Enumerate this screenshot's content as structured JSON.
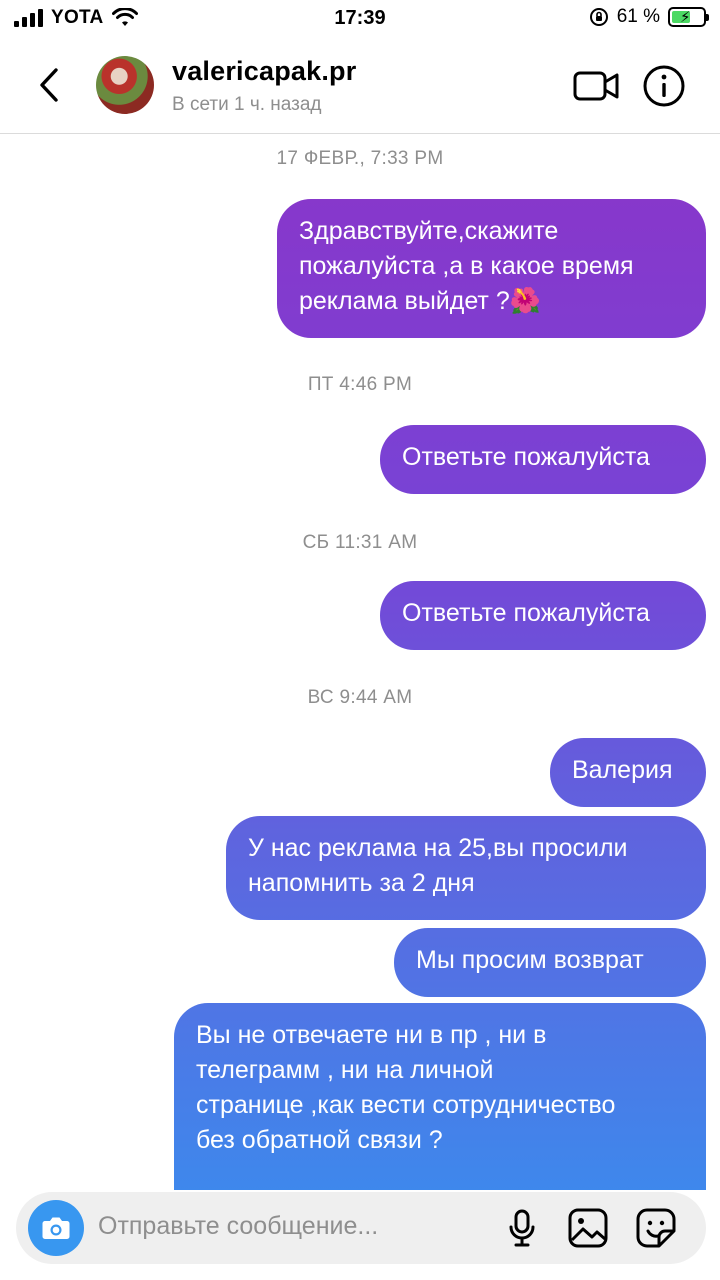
{
  "status_bar": {
    "carrier": "YOTA",
    "time": "17:39",
    "battery": "61 %",
    "battery_level": 0.61
  },
  "header": {
    "username": "valericapak.pr",
    "status": "В сети 1 ч. назад"
  },
  "messages": [
    {
      "timestamp": "17 ФЕВР., 7:33 PM"
    },
    {
      "lines": [
        "Здравствуйте,скажите",
        "пожалуйста ,а в какое время",
        "реклама выйдет ?🌺"
      ]
    },
    {
      "timestamp": "ПТ 4:46 PM"
    },
    {
      "lines": [
        "Ответьте пожалуйста"
      ]
    },
    {
      "timestamp": "СБ 11:31 AM"
    },
    {
      "lines": [
        "Ответьте пожалуйста"
      ]
    },
    {
      "timestamp": "ВС 9:44 AM"
    },
    {
      "lines": [
        "Валерия"
      ]
    },
    {
      "lines": [
        "У нас реклама на 25,вы просили",
        "напомнить за 2 дня"
      ]
    },
    {
      "lines": [
        "Мы просим  возврат"
      ]
    },
    {
      "lines": [
        "Вы не отвечаете ни в пр , ни в",
        "телеграмм , ни на личной",
        "странице ,как вести сотрудничество",
        "без обратной связи ?"
      ]
    }
  ],
  "composer": {
    "placeholder": "Отправьте сообщение..."
  },
  "colors": {
    "bubble_top": "#8a35c9",
    "bubble_bottom": "#3e88ec",
    "accent": "#3897f0"
  },
  "icons": {
    "back": "chevron-left-icon",
    "video": "video-camera-icon",
    "info": "info-icon",
    "camera": "camera-icon",
    "mic": "microphone-icon",
    "gallery": "image-icon",
    "sticker": "sticker-icon"
  }
}
